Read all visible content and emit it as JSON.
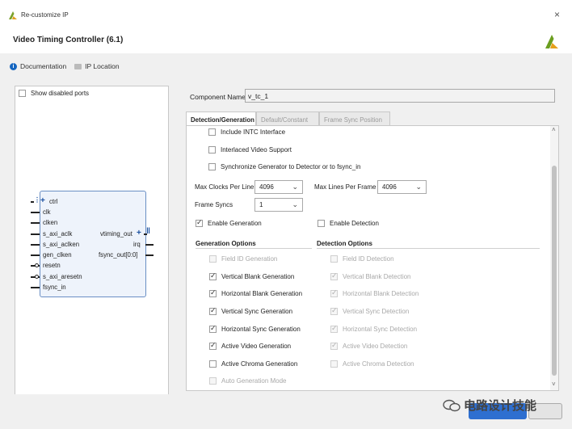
{
  "window": {
    "title": "Re-customize IP",
    "close_glyph": "×"
  },
  "header": {
    "title": "Video Timing Controller (6.1)"
  },
  "links": {
    "documentation": "Documentation",
    "ip_location": "IP Location",
    "info_glyph": "i"
  },
  "left_panel": {
    "show_disabled_label": "Show disabled ports",
    "block": {
      "left_ports": [
        "ctrl",
        "clk",
        "clken",
        "s_axi_aclk",
        "s_axi_aclken",
        "gen_clken",
        "resetn",
        "s_axi_aresetn",
        "fsync_in"
      ],
      "right_ports": [
        "vtiming_out",
        "irq",
        "fsync_out[0:0]"
      ],
      "bus_glyph": "+"
    }
  },
  "component": {
    "label": "Component Name",
    "value": "v_tc_1"
  },
  "tabs": [
    "Detection/Generation",
    "Default/Constant",
    "Frame Sync Position"
  ],
  "options": {
    "include_intc": "Include INTC Interface",
    "interlaced": "Interlaced Video Support",
    "sync_gen": "Synchronize Generator to Detector or to fsync_in"
  },
  "params": {
    "max_clocks_label": "Max Clocks Per Line",
    "max_clocks_value": "4096",
    "max_lines_label": "Max Lines Per Frame",
    "max_lines_value": "4096",
    "frame_syncs_label": "Frame Syncs",
    "frame_syncs_value": "1",
    "chevron": "⌄"
  },
  "enable": {
    "generation": "Enable Generation",
    "detection": "Enable Detection"
  },
  "generation": {
    "title": "Generation Options",
    "items": [
      "Field ID Generation",
      "Vertical Blank Generation",
      "Horizontal Blank Generation",
      "Vertical Sync Generation",
      "Horizontal Sync Generation",
      "Active Video Generation",
      "Active Chroma Generation",
      "Auto Generation Mode"
    ]
  },
  "detection": {
    "title": "Detection Options",
    "items": [
      "Field ID Detection",
      "Vertical Blank Detection",
      "Horizontal Blank Detection",
      "Vertical Sync Detection",
      "Horizontal Sync Detection",
      "Active Video Detection",
      "Active Chroma Detection"
    ]
  },
  "scroll": {
    "up": "˄",
    "down": "˅"
  },
  "watermark": {
    "text": "电路设计技能"
  },
  "colors": {
    "accent": "#2e6fd0",
    "block_border": "#6a8fc4",
    "bus": "#1a50a0"
  }
}
